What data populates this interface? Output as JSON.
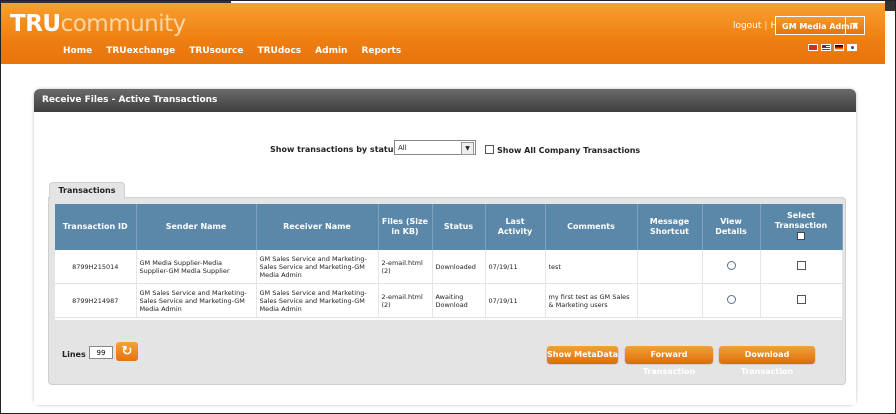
{
  "header": {
    "logo_bold": "TRU",
    "logo_light": "community",
    "nav": [
      "Home",
      "TRUexchange",
      "TRUsource",
      "TRUdocs",
      "Admin",
      "Reports"
    ],
    "logout": "logout",
    "separator": "|",
    "help": "Help",
    "user_menu": "GM Media Admin",
    "user_menu_arrow": "▼",
    "flags": [
      {
        "name": "china-flag-icon",
        "color": "#d52b1e"
      },
      {
        "name": "usa-flag-icon",
        "color": "#3c3b6e"
      },
      {
        "name": "germany-flag-icon",
        "color": "#000000"
      },
      {
        "name": "korea-flag-icon",
        "color": "#ffffff"
      }
    ]
  },
  "panel": {
    "title": "Receive Files - Active Transactions",
    "filter_label": "Show transactions by status :",
    "filter_value": "All",
    "show_all_label": "Show All Company Transactions",
    "tab": "Transactions"
  },
  "table": {
    "columns": [
      "Transaction ID",
      "Sender Name",
      "Receiver Name",
      "Files (Size in KB)",
      "Status",
      "Last Activity",
      "Comments",
      "Message Shortcut",
      "View Details",
      "Select Transaction"
    ],
    "rows": [
      {
        "id": "8799H215014",
        "sender": "GM Media Supplier-Media Supplier-GM Media Supplier",
        "receiver": "GM Sales Service and Marketing-Sales Service and Marketing-GM Media Admin",
        "files": "2-email.html (2)",
        "status": "Downloaded",
        "last_activity": "07/19/11",
        "comments": "test",
        "shortcut": ""
      },
      {
        "id": "8799H214987",
        "sender": "GM Sales Service and Marketing-Sales Service and Marketing-GM Media Admin",
        "receiver": "GM Sales Service and Marketing-Sales Service and Marketing-GM Media Admin",
        "files": "2-email.html (2)",
        "status": "Awaiting Download",
        "last_activity": "07/19/11",
        "comments": "my first test as GM Sales & Marketing users",
        "shortcut": ""
      }
    ]
  },
  "footer": {
    "lines_label": "Lines :",
    "lines_value": "99",
    "refresh_icon": "↻",
    "buttons": [
      "Show MetaData",
      "Forward Transaction",
      "Download Transaction"
    ]
  },
  "colors": {
    "brand_orange": "#ef7f12",
    "table_header": "#5b87a8",
    "panel_title": "#4a4a4a"
  }
}
